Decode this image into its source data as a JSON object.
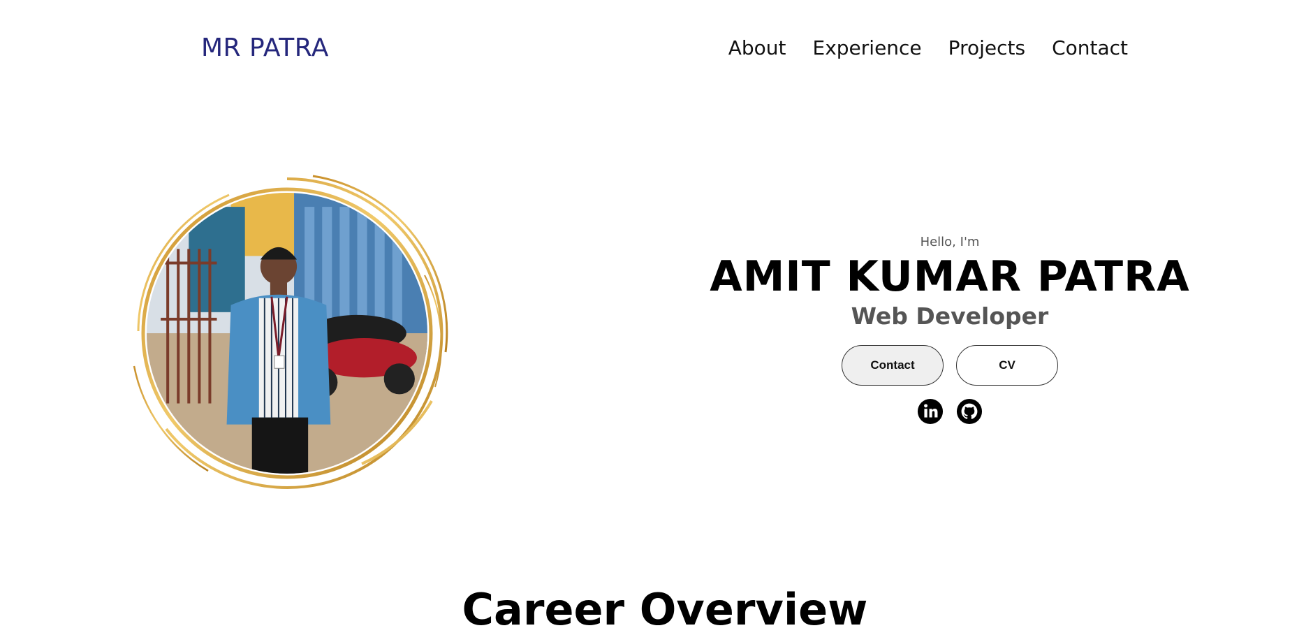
{
  "header": {
    "logo": "MR PATRA",
    "nav": [
      {
        "label": "About"
      },
      {
        "label": "Experience"
      },
      {
        "label": "Projects"
      },
      {
        "label": "Contact"
      }
    ]
  },
  "hero": {
    "greeting": "Hello, I'm",
    "name": "AMIT KUMAR PATRA",
    "role": "Web Developer",
    "buttons": {
      "contact": "Contact",
      "cv": "CV"
    },
    "socials": [
      {
        "icon": "linkedin-icon"
      },
      {
        "icon": "github-icon"
      }
    ],
    "portrait": {
      "subject": "profile-photo",
      "ring_color": "#d4a443"
    }
  },
  "sections": {
    "career_title": "Career Overview"
  },
  "colors": {
    "logo": "#25277c",
    "text": "#000000",
    "muted": "#555555",
    "gold": "#d4a443"
  }
}
